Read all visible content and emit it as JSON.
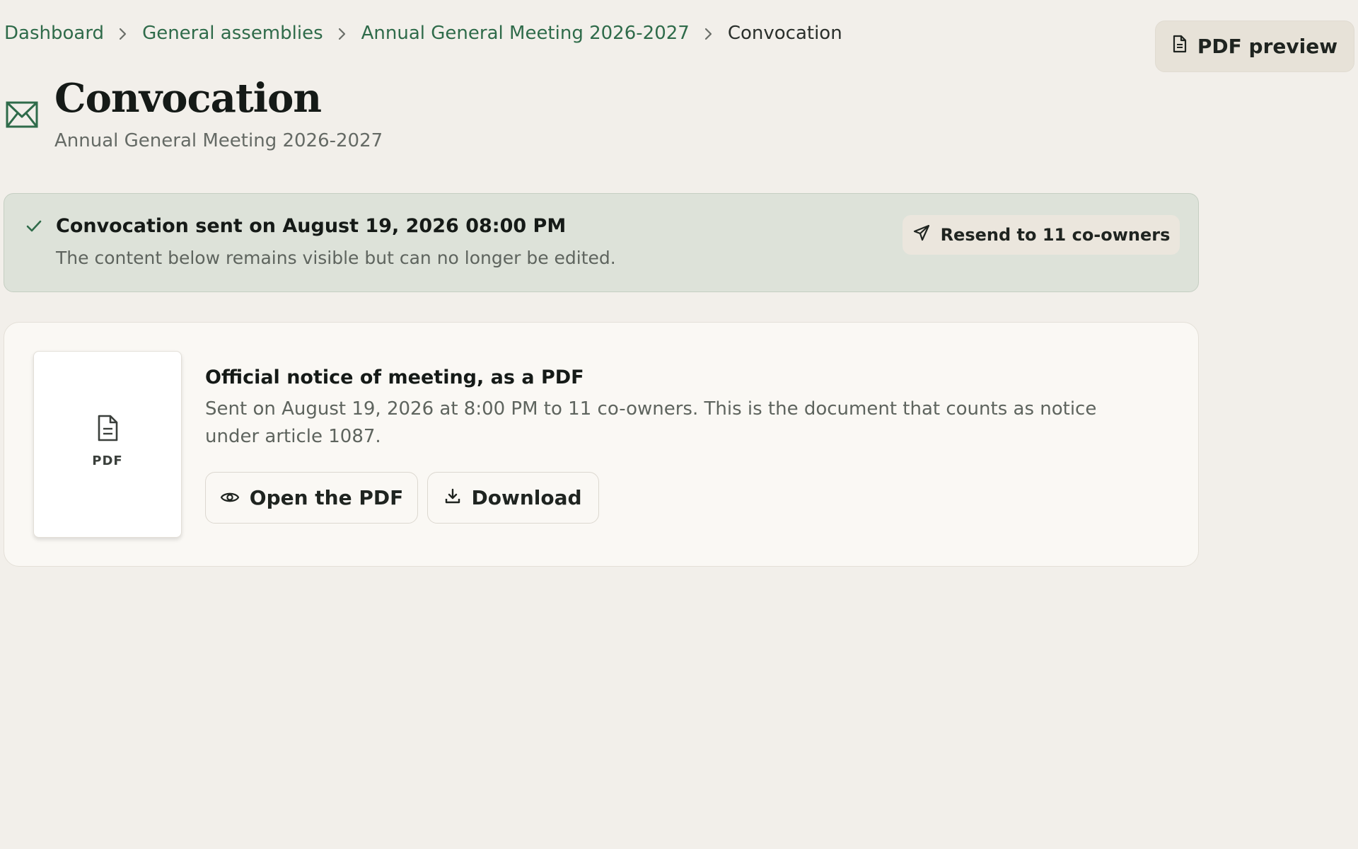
{
  "breadcrumb": {
    "items": [
      {
        "label": "Dashboard"
      },
      {
        "label": "General assemblies"
      },
      {
        "label": "Annual General Meeting 2026-2027"
      }
    ],
    "current": "Convocation"
  },
  "header": {
    "title": "Convocation",
    "subtitle": "Annual General Meeting 2026-2027",
    "icon": "envelope-icon",
    "pdf_preview_label": "PDF preview"
  },
  "banner": {
    "title": "Convocation sent on August 19, 2026 08:00 PM",
    "text": "The content below remains visible but can no longer be edited.",
    "resend_label": "Resend to 11 co-owners"
  },
  "document": {
    "thumb_label": "PDF",
    "title": "Official notice of meeting, as a PDF",
    "description": "Sent on August 19, 2026 at 8:00 PM to 11 co-owners. This is the document that counts as notice under article 1087.",
    "open_label": "Open the PDF",
    "download_label": "Download"
  },
  "colors": {
    "accent": "#2f6b4a",
    "background": "#f2efea",
    "banner_bg": "#dde2d9",
    "card_bg": "#faf8f4"
  }
}
